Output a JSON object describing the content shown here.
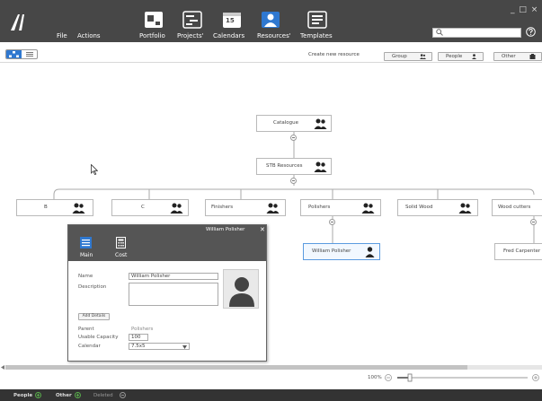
{
  "menu": {
    "file": "File",
    "actions": "Actions"
  },
  "nav": {
    "portfolio": "Portfolio",
    "projects": "Projects'",
    "calendars": "Calendars",
    "calendar_icon_text": "15",
    "resources": "Resources'",
    "templates": "Templates"
  },
  "search": {
    "placeholder": ""
  },
  "window_controls": "_ □ ×",
  "toolbar": {
    "create_new": "Create new resource",
    "group": "Group",
    "people": "People",
    "other": "Other"
  },
  "tree": {
    "root": "Catalogue",
    "level1": "STB Resources",
    "children": [
      "B",
      "C",
      "Finishers",
      "Polishers",
      "Solid Wood",
      "Wood cutters"
    ],
    "polishers_child": "William Polisher",
    "woodcutters_child": "Fred Carpenter"
  },
  "popup": {
    "title": "William Polisher",
    "tab_main": "Main",
    "tab_cost": "Cost",
    "name_label": "Name",
    "name_value": "William Polisher",
    "description_label": "Description",
    "description_value": "",
    "add_details": "Add Details",
    "parent_label": "Parent",
    "parent_value": "Polishers",
    "capacity_label": "Usable Capacity",
    "capacity_value": "100",
    "calendar_label": "Calendar",
    "calendar_value": "7.5x5"
  },
  "zoom": {
    "label": "100%",
    "level_percent": 100
  },
  "status": {
    "people": "People",
    "other": "Other",
    "deleted": "Deleted"
  },
  "colors": {
    "accent": "#2f78d0",
    "topbar": "#474747",
    "status_green": "#5ab04c"
  }
}
